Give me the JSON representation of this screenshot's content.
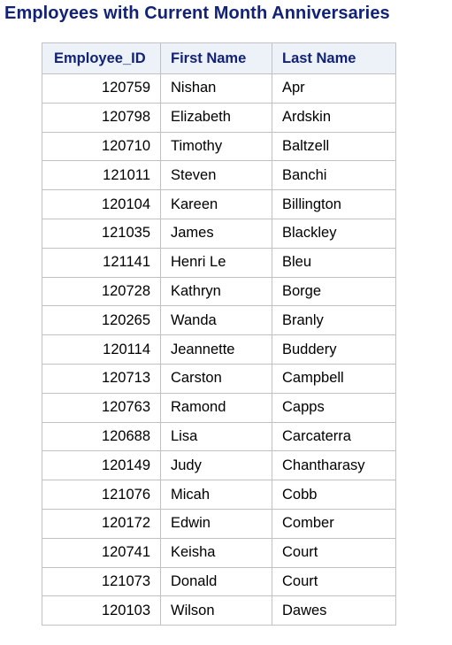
{
  "title": "Employees with Current Month Anniversaries",
  "table": {
    "headers": [
      "Employee_ID",
      "First Name",
      "Last Name"
    ],
    "rows": [
      [
        "120759",
        "Nishan",
        "Apr"
      ],
      [
        "120798",
        "Elizabeth",
        "Ardskin"
      ],
      [
        "120710",
        "Timothy",
        "Baltzell"
      ],
      [
        "121011",
        "Steven",
        "Banchi"
      ],
      [
        "120104",
        "Kareen",
        "Billington"
      ],
      [
        "121035",
        "James",
        "Blackley"
      ],
      [
        "121141",
        "Henri Le",
        "Bleu"
      ],
      [
        "120728",
        "Kathryn",
        "Borge"
      ],
      [
        "120265",
        "Wanda",
        "Branly"
      ],
      [
        "120114",
        "Jeannette",
        "Buddery"
      ],
      [
        "120713",
        "Carston",
        "Campbell"
      ],
      [
        "120763",
        "Ramond",
        "Capps"
      ],
      [
        "120688",
        "Lisa",
        "Carcaterra"
      ],
      [
        "120149",
        "Judy",
        "Chantharasy"
      ],
      [
        "121076",
        "Micah",
        "Cobb"
      ],
      [
        "120172",
        "Edwin",
        "Comber"
      ],
      [
        "120741",
        "Keisha",
        "Court"
      ],
      [
        "121073",
        "Donald",
        "Court"
      ],
      [
        "120103",
        "Wilson",
        "Dawes"
      ]
    ]
  },
  "colors": {
    "title": "#112277",
    "header_bg": "#edf2f9",
    "border": "#c1c1c1"
  }
}
